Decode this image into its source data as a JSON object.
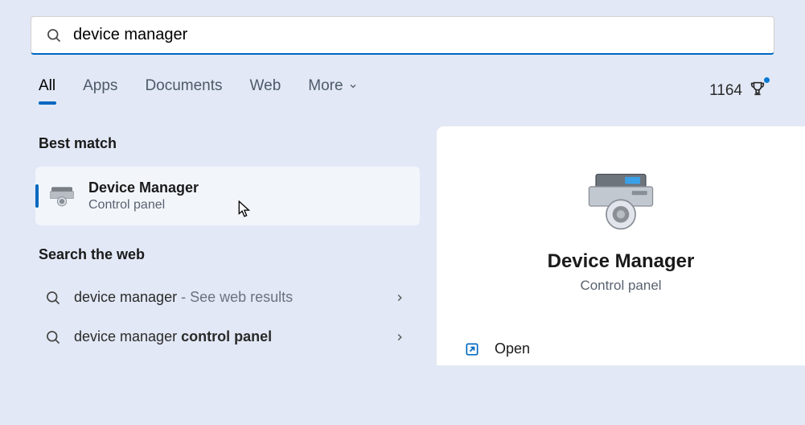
{
  "search": {
    "query": "device manager"
  },
  "tabs": {
    "all": "All",
    "apps": "Apps",
    "documents": "Documents",
    "web": "Web",
    "more": "More"
  },
  "rewards": {
    "points": "1164"
  },
  "sections": {
    "best_match": "Best match",
    "search_web": "Search the web"
  },
  "best_match": {
    "title": "Device Manager",
    "subtitle": "Control panel"
  },
  "web_results": [
    {
      "text": "device manager",
      "hint": " - See web results"
    },
    {
      "prefix": "device manager ",
      "bold": "control panel"
    }
  ],
  "detail": {
    "title": "Device Manager",
    "subtitle": "Control panel",
    "open": "Open"
  }
}
